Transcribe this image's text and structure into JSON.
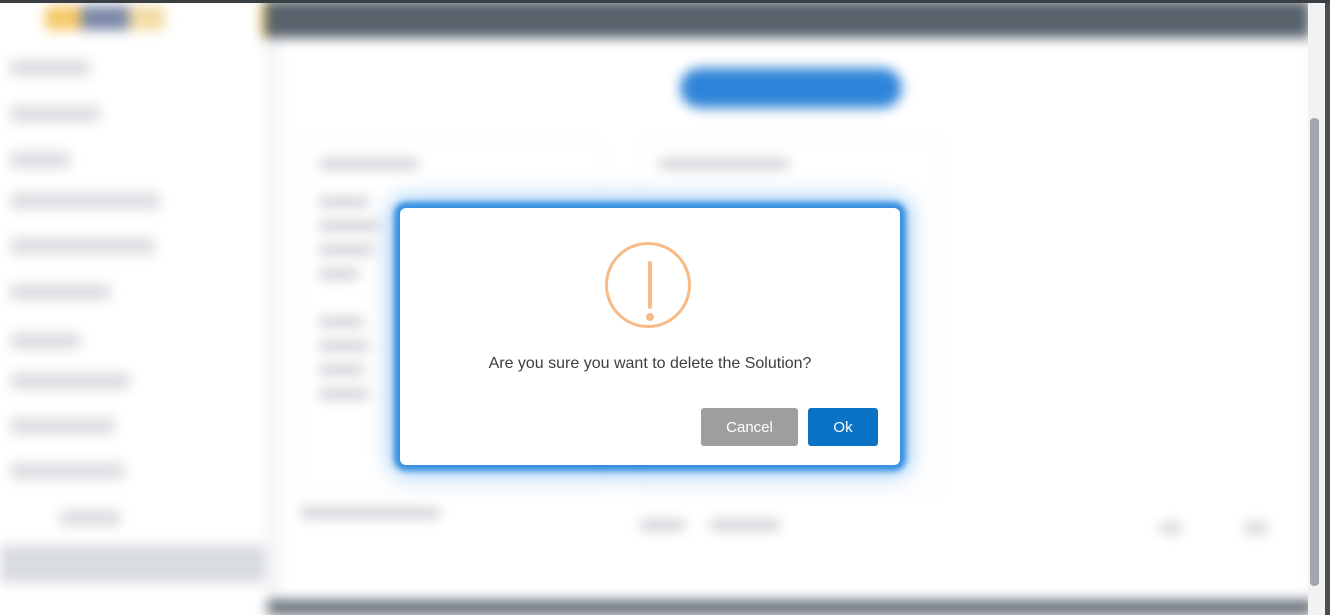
{
  "dialog": {
    "icon": "warning-exclamation-icon",
    "message": "Are you sure you want to delete the Solution?",
    "cancel_label": "Cancel",
    "ok_label": "Ok"
  },
  "colors": {
    "warning_icon": "#f8bb86",
    "ok_button": "#0b73c6",
    "cancel_button": "#9e9e9e",
    "dialog_glow": "#1e82dc",
    "topbar": "#4a5660",
    "topbar_accent": "#f4b400"
  }
}
